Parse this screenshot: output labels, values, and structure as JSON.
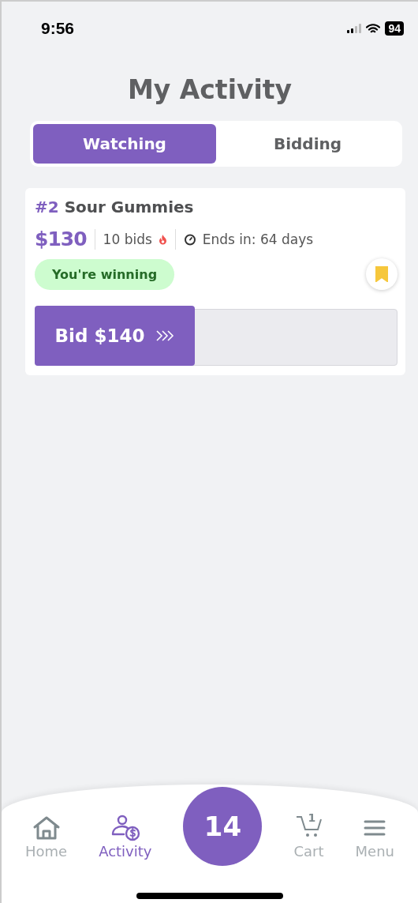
{
  "status_bar": {
    "time": "9:56",
    "battery": "94"
  },
  "title": "My Activity",
  "tabs": [
    {
      "label": "Watching",
      "selected": true
    },
    {
      "label": "Bidding",
      "selected": false
    }
  ],
  "lots": [
    {
      "number": "#2",
      "name": "Sour Gummies",
      "price": "$130",
      "bids": "10 bids",
      "hot": true,
      "ends": "Ends in: 64 days",
      "badge": "You're winning",
      "bookmarked": true,
      "bid_button": "Bid $140"
    }
  ],
  "nav": [
    {
      "kind": "home",
      "label": "Home",
      "selected": false
    },
    {
      "kind": "activity",
      "label": "Activity",
      "selected": true
    },
    {
      "kind": "center",
      "count": "14"
    },
    {
      "kind": "cart",
      "label": "Cart",
      "count": "1",
      "selected": false
    },
    {
      "kind": "menu",
      "label": "Menu",
      "selected": false
    }
  ]
}
